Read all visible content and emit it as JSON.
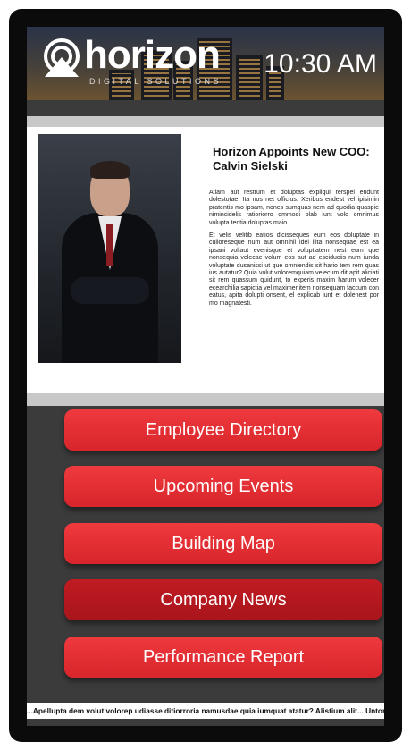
{
  "header": {
    "brand_name": "horizon",
    "brand_tagline": "DIGITAL SOLUTIONS",
    "time": "10:30 AM"
  },
  "article": {
    "title": "Horizon Appoints New COO: Calvin Sielski",
    "paragraphs": [
      "Atiam aut restrum et doluptas expliqui rerspel endunt dolestotae. Ita nos net officius. Xeribus endest vel ipisimin pratentis mo ipsam, nones sumquas nem ad quodia quaspie nimincidelis ratioriorro ommodi blab iunt volo omnimus volupta tentia doluptas maio.",
      "Et velis velitib eatios dicisseques eum eos doluptate in culloreseque num aut omnihil idel ilita nonsequae est ea ipsani vollaut evenisque et voluptiatem nest eum que nonsequia velecae volum eos aut ad esciduciis num iunda voluptate dusanissi ut que omniendis sit hario tem rem quas ius autatur? Quia volut voloremquiam velecum dit apit aliciati sit rem quassum quidunt, to experis maxim harum volecer ecearchilia sapictia vel maximenitem nonsequam faccum con eatus, apita dolupti onsent, el explicab iunt et dolenest por mo magnatesti."
    ]
  },
  "menu": {
    "items": [
      {
        "label": "Employee Directory"
      },
      {
        "label": "Upcoming Events"
      },
      {
        "label": "Building Map"
      },
      {
        "label": "Company News"
      },
      {
        "label": "Performance Report"
      }
    ]
  },
  "ticker": {
    "text": "...Apellupta dem volut volorep udiasse ditiorroria namusdae quia iumquat atatur? Alistium alit... Untorehenem..."
  },
  "colors": {
    "accent_red": "#e0282e",
    "active_red": "#b3181e",
    "screen_bg": "#3b3b3c"
  },
  "icons": {
    "logo": "horizon-logo-icon"
  }
}
